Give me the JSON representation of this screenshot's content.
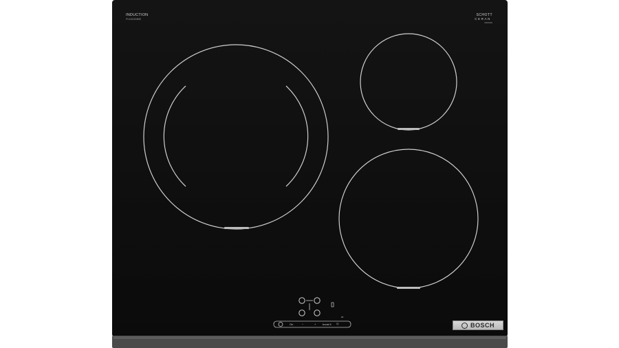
{
  "hob": {
    "top_left_label": "INDUCTION",
    "top_left_model": "PUG631BB5E",
    "glass_brand_line1": "SCHOTT",
    "glass_brand_line2": "CERAN",
    "glass_brand_code": "0000000",
    "manufacturer": "BOSCH",
    "controls": {
      "on_label": "On",
      "minus_label": "−",
      "plus_label": "+",
      "boost_label": "boost ‖",
      "timer_label": "◷",
      "small_mark": "0/I"
    }
  }
}
